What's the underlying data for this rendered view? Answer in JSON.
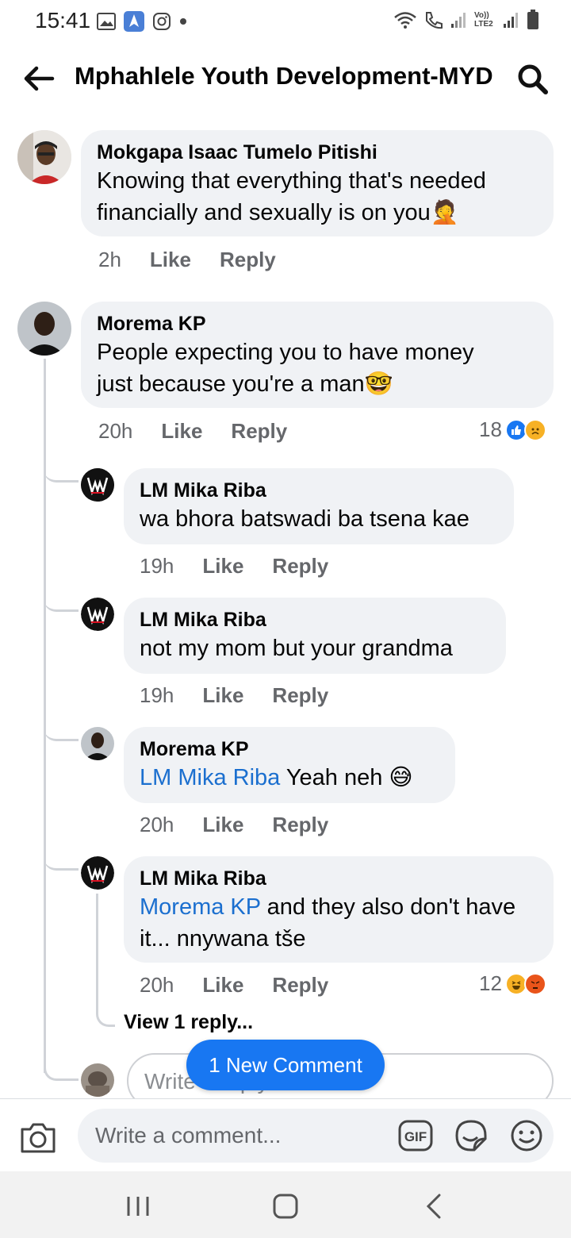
{
  "status_bar": {
    "time": "15:41",
    "left_icons": [
      "gallery-icon",
      "app-icon",
      "instagram-icon",
      "dot-icon"
    ],
    "right_icons": [
      "wifi-icon",
      "call-icon",
      "signal-icon",
      "volte-icon",
      "signal-icon",
      "battery-icon"
    ],
    "volte_label": "Vo)) LTE2"
  },
  "header": {
    "title": "Mphahlele Youth Development-MYD"
  },
  "comments": [
    {
      "name": "Mokgapa Isaac Tumelo Pitishi",
      "text_line1": "Knowing that everything that's needed",
      "text_line2": "financially and sexually is on you",
      "emoji": "🤦",
      "time": "2h",
      "like": "Like",
      "reply": "Reply"
    },
    {
      "name": "Morema KP",
      "text_line1": "People expecting you to have money",
      "text_line2": "just because you're a man",
      "emoji": "🤓",
      "time": "20h",
      "like": "Like",
      "reply": "Reply",
      "reaction_count": "18",
      "reactions": [
        "like-icon",
        "sad-icon"
      ]
    }
  ],
  "replies": [
    {
      "name": "LM Mika Riba",
      "text": "wa bhora batswadi ba tsena kae",
      "time": "19h",
      "like": "Like",
      "reply": "Reply"
    },
    {
      "name": "LM Mika Riba",
      "text": "not my mom but your grandma",
      "time": "19h",
      "like": "Like",
      "reply": "Reply"
    },
    {
      "name": "Morema KP",
      "mention": "LM Mika Riba",
      "text": " Yeah neh ",
      "emoji": "😅",
      "time": "20h",
      "like": "Like",
      "reply": "Reply"
    },
    {
      "name": "LM Mika Riba",
      "mention": "Morema KP",
      "text_line1": " and they also don't have",
      "text_line2": "it... nnywana tše",
      "time": "20h",
      "like": "Like",
      "reply": "Reply",
      "reaction_count": "12",
      "reactions": [
        "haha-icon",
        "angry-icon"
      ]
    }
  ],
  "view_replies": "View 1 reply...",
  "reply_placeholder": "Write a reply...",
  "new_comment_pill": "1 New Comment",
  "composer": {
    "placeholder": "Write a comment...",
    "gif_label": "GIF"
  },
  "colors": {
    "brand_blue": "#1877f2",
    "mention_blue": "#1b6fcf",
    "bubble_bg": "#f0f2f5",
    "meta_gray": "#65676b"
  }
}
